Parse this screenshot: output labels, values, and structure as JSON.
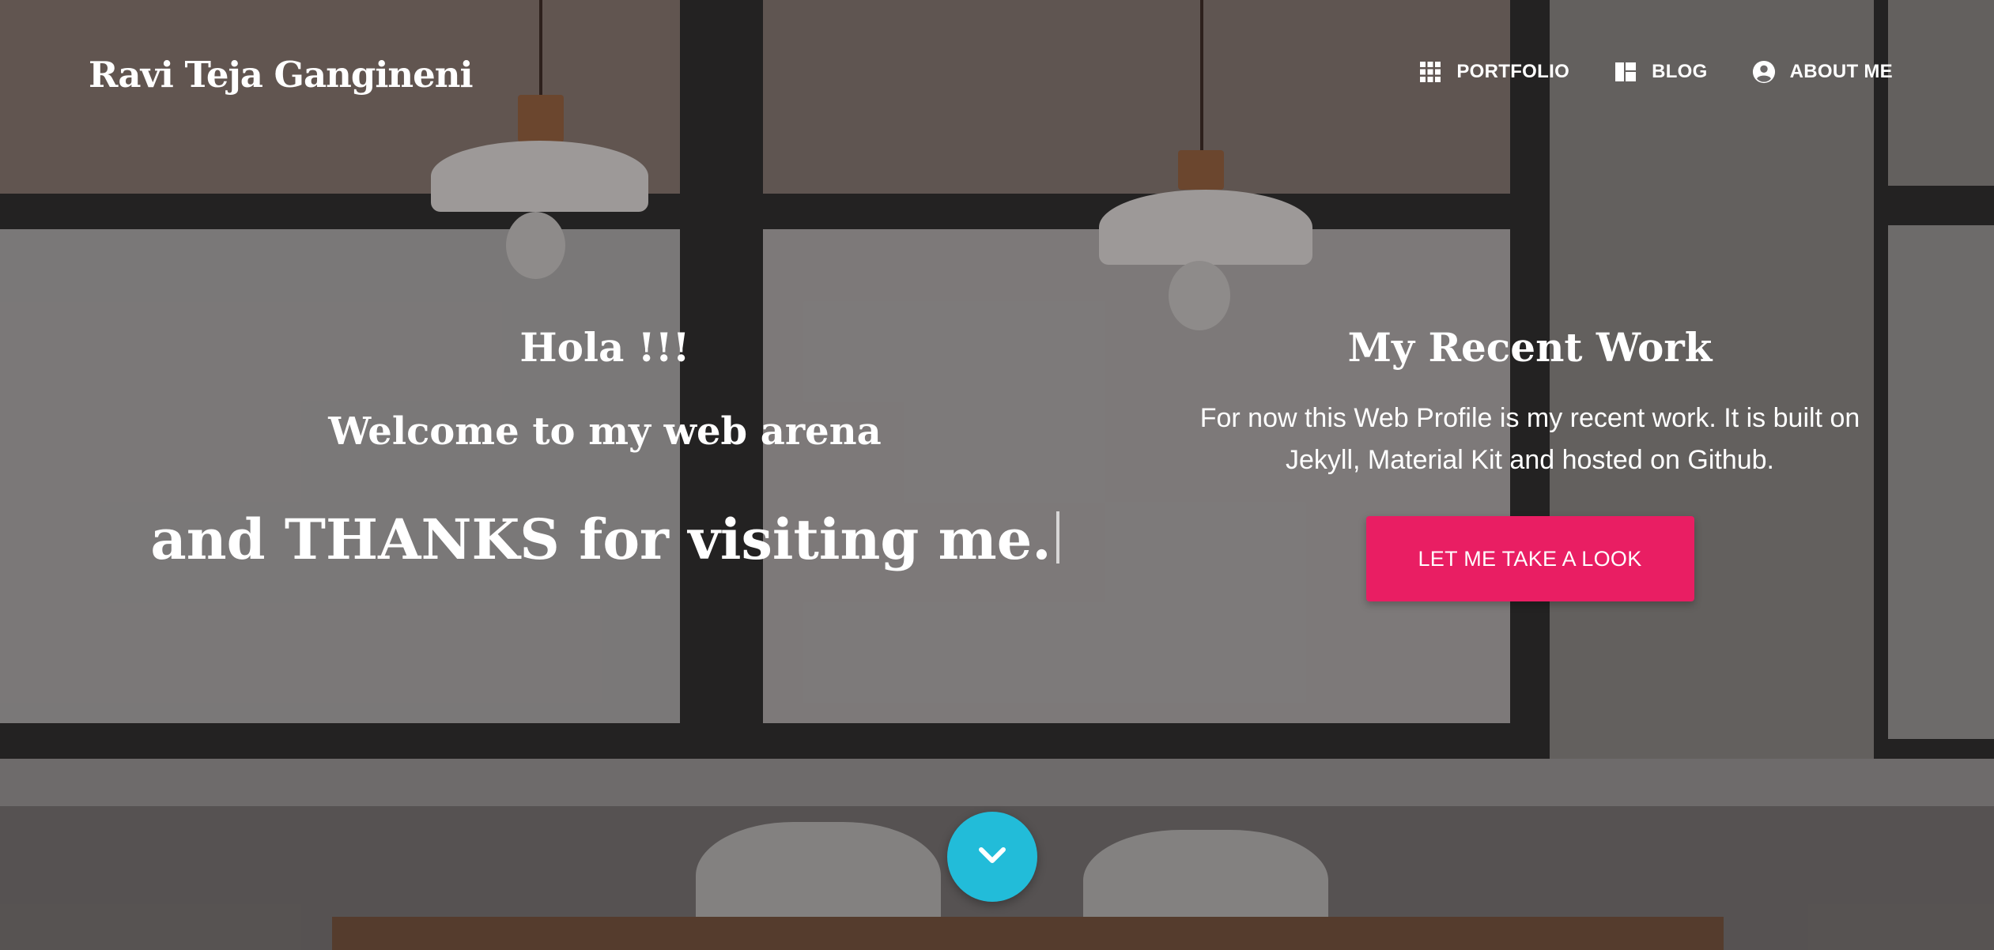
{
  "brand": {
    "name": "Ravi Teja Gangineni"
  },
  "nav": {
    "items": [
      {
        "label": "PORTFOLIO",
        "icon": "apps-grid-icon"
      },
      {
        "label": "BLOG",
        "icon": "dashboard-icon"
      },
      {
        "label": "ABOUT ME",
        "icon": "account-circle-icon"
      }
    ]
  },
  "intro": {
    "greeting": "Hola !!!",
    "welcome": "Welcome to my web arena",
    "typed_text": "and THANKS for visiting me."
  },
  "recent_work": {
    "title": "My Recent Work",
    "description": "For now this Web Profile is my recent work. It is built on Jekyll, Material Kit and hosted on Github.",
    "button_label": "LET ME TAKE A LOOK"
  },
  "scroll": {
    "icon": "chevron-down-icon"
  },
  "colors": {
    "accent_pink": "#e91e63",
    "scroll_cyan": "#22bcd9"
  }
}
